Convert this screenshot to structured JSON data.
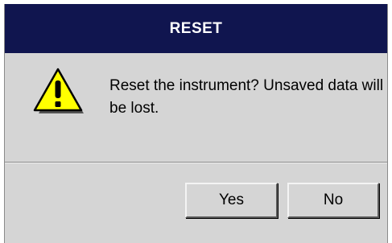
{
  "dialog": {
    "title": "RESET",
    "message": "Reset the instrument? Unsaved data will be lost.",
    "icon": "warning-icon",
    "buttons": {
      "yes_label": "Yes",
      "no_label": "No"
    }
  },
  "colors": {
    "titlebar": "#10154f",
    "title_text": "#ffffff",
    "dialog_bg": "#d5d5d5",
    "warning_fill": "#ffff00",
    "warning_stroke": "#000000"
  }
}
